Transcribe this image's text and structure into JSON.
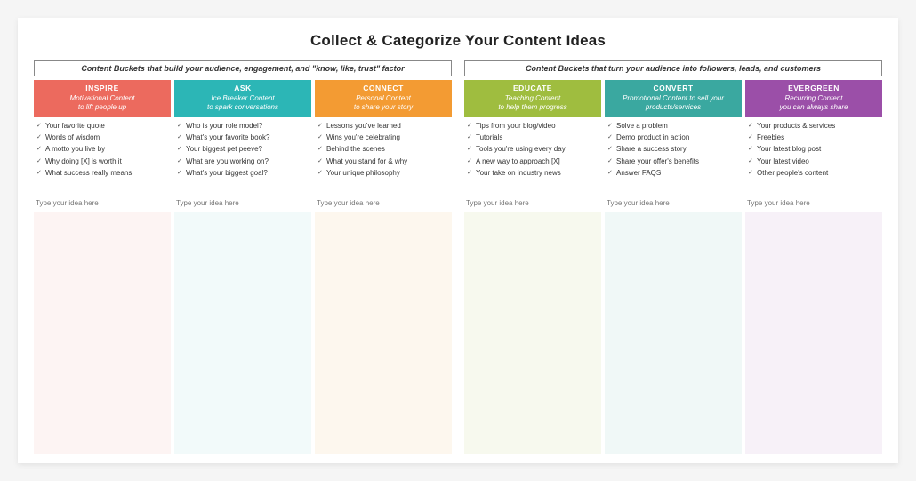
{
  "title": "Collect & Categorize Your Content Ideas",
  "groups": [
    {
      "header": "Content Buckets that build your audience, engagement, and \"know, like, trust\" factor",
      "buckets": [
        {
          "name": "INSPIRE",
          "subtitle": "Motivational Content",
          "tagline": "to lift people up",
          "items": [
            "Your favorite quote",
            "Words of wisdom",
            "A motto you live by",
            "Why doing [X] is worth it",
            "What success really means"
          ],
          "placeholder": "Type your idea here"
        },
        {
          "name": "ASK",
          "subtitle": "Ice Breaker Content",
          "tagline": "to spark conversations",
          "items": [
            "Who is your role model?",
            "What's your favorite book?",
            "Your biggest pet peeve?",
            "What are you working on?",
            "What's your biggest goal?"
          ],
          "placeholder": "Type your idea here"
        },
        {
          "name": "CONNECT",
          "subtitle": "Personal Content",
          "tagline": "to share your story",
          "items": [
            "Lessons you've learned",
            "Wins you're celebrating",
            "Behind the scenes",
            "What you stand for & why",
            "Your unique philosophy"
          ],
          "placeholder": "Type your idea here"
        }
      ]
    },
    {
      "header": "Content Buckets that turn your audience into followers, leads, and customers",
      "buckets": [
        {
          "name": "EDUCATE",
          "subtitle": "Teaching Content",
          "tagline": "to help them progress",
          "items": [
            "Tips from your blog/video",
            "Tutorials",
            "Tools you're using every day",
            "A new way to approach [X]",
            "Your take on industry news"
          ],
          "placeholder": "Type your idea here"
        },
        {
          "name": "CONVERT",
          "subtitle": "Promotional Content to sell your",
          "tagline": "products/services",
          "items": [
            "Solve a problem",
            "Demo product in action",
            "Share a success story",
            "Share your offer's benefits",
            "Answer FAQS"
          ],
          "placeholder": "Type your idea here"
        },
        {
          "name": "EVERGREEN",
          "subtitle": "Recurring Content",
          "tagline": "you can always share",
          "items": [
            "Your products & services",
            "Freebies",
            "Your latest blog post",
            "Your latest video",
            "Other people's content"
          ],
          "placeholder": "Type your idea here"
        }
      ]
    }
  ]
}
